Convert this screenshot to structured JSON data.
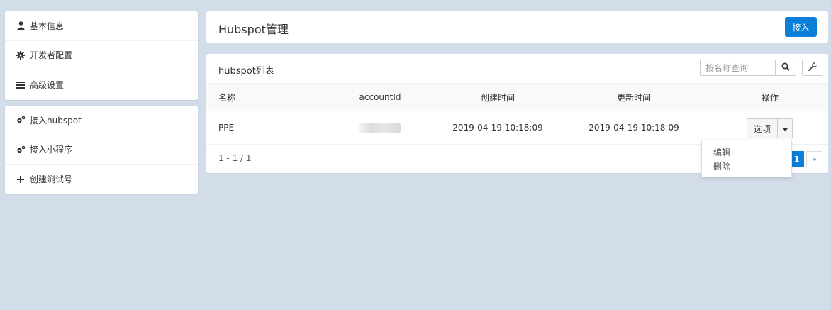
{
  "sidebar": {
    "group1": [
      {
        "label": "基本信息",
        "icon": "user-icon"
      },
      {
        "label": "开发者配置",
        "icon": "gear-icon"
      },
      {
        "label": "高级设置",
        "icon": "list-icon"
      }
    ],
    "group2": [
      {
        "label": "接入hubspot",
        "icon": "gears-icon"
      },
      {
        "label": "接入小程序",
        "icon": "gears-icon"
      },
      {
        "label": "创建测试号",
        "icon": "plus-icon"
      }
    ]
  },
  "header": {
    "title": "Hubspot管理",
    "connect_label": "接入"
  },
  "list": {
    "title": "hubspot列表",
    "search_placeholder": "按名称查询",
    "columns": [
      "名称",
      "accountId",
      "创建时间",
      "更新时间",
      "操作"
    ],
    "rows": [
      {
        "name": "PPE",
        "account_id": "",
        "created": "2019-04-19 10:18:09",
        "updated": "2019-04-19 10:18:09",
        "op_label": "选项"
      }
    ],
    "count": "1 - 1 / 1",
    "page": "1",
    "next": "»"
  },
  "dropdown": {
    "items": [
      "编辑",
      "删除"
    ]
  },
  "colors": {
    "accent": "#0a7fd8",
    "background": "#d2dde9"
  }
}
